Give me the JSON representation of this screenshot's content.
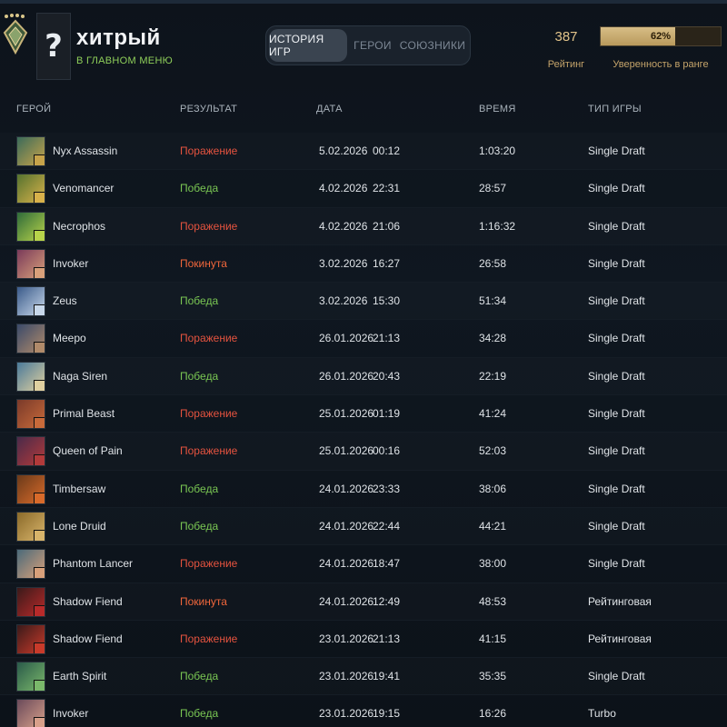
{
  "player": {
    "name": "хитрый",
    "status": "В ГЛАВНОМ МЕНЮ",
    "avatar_glyph": "?"
  },
  "tabs": [
    {
      "label": "ИСТОРИЯ ИГР",
      "active": true
    },
    {
      "label": "ГЕРОИ",
      "active": false
    },
    {
      "label": "СОЮЗНИКИ",
      "active": false
    }
  ],
  "rating": {
    "value": "387",
    "label": "Рейтинг",
    "confidence_text": "62%",
    "confidence_fraction": 0.62,
    "confidence_label": "Уверенность в ранге"
  },
  "table": {
    "headers": {
      "hero": "ГЕРОЙ",
      "result": "РЕЗУЛЬТАТ",
      "date": "ДАТА",
      "duration": "ВРЕМЯ",
      "game_type": "ТИП ИГРЫ"
    },
    "rows": [
      {
        "hero": "Nyx Assassin",
        "result": "Поражение",
        "result_kind": "loss",
        "date": "5.02.2026",
        "time": "00:12",
        "duration": "1:03:20",
        "type": "Single Draft"
      },
      {
        "hero": "Venomancer",
        "result": "Победа",
        "result_kind": "win",
        "date": "4.02.2026",
        "time": "22:31",
        "duration": "28:57",
        "type": "Single Draft"
      },
      {
        "hero": "Necrophos",
        "result": "Поражение",
        "result_kind": "loss",
        "date": "4.02.2026",
        "time": "21:06",
        "duration": "1:16:32",
        "type": "Single Draft"
      },
      {
        "hero": "Invoker",
        "result": "Покинута",
        "result_kind": "abandon",
        "date": "3.02.2026",
        "time": "16:27",
        "duration": "26:58",
        "type": "Single Draft"
      },
      {
        "hero": "Zeus",
        "result": "Победа",
        "result_kind": "win",
        "date": "3.02.2026",
        "time": "15:30",
        "duration": "51:34",
        "type": "Single Draft"
      },
      {
        "hero": "Meepo",
        "result": "Поражение",
        "result_kind": "loss",
        "date": "26.01.2026",
        "time": "21:13",
        "duration": "34:28",
        "type": "Single Draft"
      },
      {
        "hero": "Naga Siren",
        "result": "Победа",
        "result_kind": "win",
        "date": "26.01.2026",
        "time": "20:43",
        "duration": "22:19",
        "type": "Single Draft"
      },
      {
        "hero": "Primal Beast",
        "result": "Поражение",
        "result_kind": "loss",
        "date": "25.01.2026",
        "time": "01:19",
        "duration": "41:24",
        "type": "Single Draft"
      },
      {
        "hero": "Queen of Pain",
        "result": "Поражение",
        "result_kind": "loss",
        "date": "25.01.2026",
        "time": "00:16",
        "duration": "52:03",
        "type": "Single Draft"
      },
      {
        "hero": "Timbersaw",
        "result": "Победа",
        "result_kind": "win",
        "date": "24.01.2026",
        "time": "23:33",
        "duration": "38:06",
        "type": "Single Draft"
      },
      {
        "hero": "Lone Druid",
        "result": "Победа",
        "result_kind": "win",
        "date": "24.01.2026",
        "time": "22:44",
        "duration": "44:21",
        "type": "Single Draft"
      },
      {
        "hero": "Phantom Lancer",
        "result": "Поражение",
        "result_kind": "loss",
        "date": "24.01.2026",
        "time": "18:47",
        "duration": "38:00",
        "type": "Single Draft"
      },
      {
        "hero": "Shadow Fiend",
        "result": "Покинута",
        "result_kind": "abandon",
        "date": "24.01.2026",
        "time": "12:49",
        "duration": "48:53",
        "type": "Рейтинговая"
      },
      {
        "hero": "Shadow Fiend",
        "result": "Поражение",
        "result_kind": "loss",
        "date": "23.01.2026",
        "time": "21:13",
        "duration": "41:15",
        "type": "Рейтинговая"
      },
      {
        "hero": "Earth Spirit",
        "result": "Победа",
        "result_kind": "win",
        "date": "23.01.2026",
        "time": "19:41",
        "duration": "35:35",
        "type": "Single Draft"
      },
      {
        "hero": "Invoker",
        "result": "Победа",
        "result_kind": "win",
        "date": "23.01.2026",
        "time": "19:15",
        "duration": "16:26",
        "type": "Turbo"
      }
    ]
  },
  "icons": {
    "rank_badge": "rank-medal-icon",
    "hero_portrait": "hero-portrait-icon",
    "facet": "facet-icon"
  },
  "colors": {
    "win": "#7ac753",
    "loss": "#e5533f",
    "abandon": "#f0663b",
    "rating_gold": "#e2c48a",
    "status_green": "#8fcf5a"
  }
}
